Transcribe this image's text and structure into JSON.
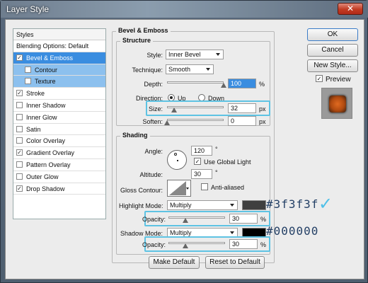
{
  "window": {
    "title": "Layer Style",
    "close_glyph": "✕"
  },
  "styles_panel": {
    "header": "Styles",
    "blending_row": "Blending Options: Default",
    "items": [
      {
        "label": "Bevel & Emboss",
        "checked": true,
        "selected": true
      },
      {
        "label": "Contour",
        "checked": false,
        "sub": true
      },
      {
        "label": "Texture",
        "checked": false,
        "sub": true
      },
      {
        "label": "Stroke",
        "checked": true
      },
      {
        "label": "Inner Shadow",
        "checked": false
      },
      {
        "label": "Inner Glow",
        "checked": false
      },
      {
        "label": "Satin",
        "checked": false
      },
      {
        "label": "Color Overlay",
        "checked": false
      },
      {
        "label": "Gradient Overlay",
        "checked": true
      },
      {
        "label": "Pattern Overlay",
        "checked": false
      },
      {
        "label": "Outer Glow",
        "checked": false
      },
      {
        "label": "Drop Shadow",
        "checked": true
      }
    ]
  },
  "bevel": {
    "group_title": "Bevel & Emboss",
    "structure_title": "Structure",
    "style_label": "Style:",
    "style_value": "Inner Bevel",
    "technique_label": "Technique:",
    "technique_value": "Smooth",
    "depth_label": "Depth:",
    "depth_value": "100",
    "depth_unit": "%",
    "depth_level": 1.0,
    "direction_label": "Direction:",
    "direction_up": "Up",
    "direction_down": "Down",
    "size_label": "Size:",
    "size_value": "32",
    "size_unit": "px",
    "size_level": 0.13,
    "soften_label": "Soften:",
    "soften_value": "0",
    "soften_unit": "px",
    "soften_level": 0.0
  },
  "shading": {
    "title": "Shading",
    "angle_label": "Angle:",
    "angle_value": "120",
    "angle_unit": "°",
    "global_light_label": "Use Global Light",
    "altitude_label": "Altitude:",
    "altitude_value": "30",
    "altitude_unit": "°",
    "gloss_label": "Gloss Contour:",
    "anti_aliased_label": "Anti-aliased",
    "highlight_mode_label": "Highlight Mode:",
    "highlight_mode_value": "Multiply",
    "highlight_color": "#3f3f3f",
    "highlight_opacity_label": "Opacity:",
    "highlight_opacity_value": "30",
    "highlight_opacity_unit": "%",
    "highlight_opacity_level": 0.3,
    "shadow_mode_label": "Shadow Mode:",
    "shadow_mode_value": "Multiply",
    "shadow_color": "#000000",
    "shadow_opacity_label": "Opacity:",
    "shadow_opacity_value": "30",
    "shadow_opacity_unit": "%",
    "shadow_opacity_level": 0.3
  },
  "buttons": {
    "ok": "OK",
    "cancel": "Cancel",
    "new_style": "New Style...",
    "preview": "Preview",
    "make_default": "Make Default",
    "reset_default": "Reset to Default"
  },
  "annotations": {
    "highlight_hex": "#3f3f3f",
    "shadow_hex": "#000000",
    "check_glyph": "✓"
  },
  "colors": {
    "accent_select": "#3a8de0",
    "annotation_box": "#5ec3e3",
    "annotation_check": "#4fc0e8"
  }
}
